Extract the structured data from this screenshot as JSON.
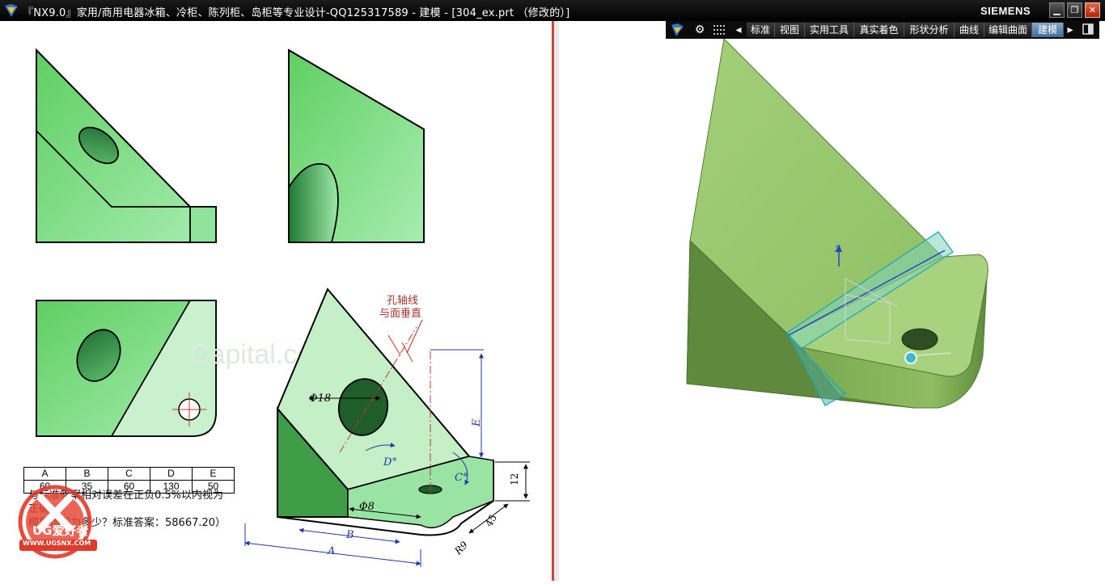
{
  "window": {
    "title": "『NX9.0』家用/商用电器冰箱、冷柜、陈列柜、岛柜等专业设计-QQ125317589 - 建模 - [304_ex.prt （修改的）]",
    "brand": "SIEMENS",
    "controls": [
      "minimize",
      "restore",
      "close"
    ]
  },
  "toolbar": {
    "tabs": [
      "标准",
      "视图",
      "实用工具",
      "真实着色",
      "形状分析",
      "曲线",
      "编辑曲面",
      "建模"
    ],
    "active_tab": "建模"
  },
  "drawing": {
    "annotation": [
      "孔轴线",
      "与面垂直"
    ],
    "dim_hole": "Φ18",
    "dim_small_hole": "Φ8",
    "dim_A": "A",
    "dim_B": "B",
    "dim_C": "C°",
    "dim_D": "D°",
    "dim_E": "E",
    "dim_12": "12",
    "dim_45": "45",
    "dim_r9": "R9",
    "watermark": "Capital.com"
  },
  "table": {
    "headers": [
      "A",
      "B",
      "C",
      "D",
      "E"
    ],
    "values": [
      "60",
      "35",
      "60",
      "130",
      "50"
    ]
  },
  "notes": {
    "line1": "与标准答案相对误差在正负0.5%以内视为",
    "line2": "正确",
    "line3": "模型体积为多少？标准答案：58667.20）"
  },
  "logo": {
    "text": "UG爱好者",
    "url": "WWW.UGSNX.COM"
  },
  "viewport": {
    "axis_label": "Z"
  },
  "colors": {
    "part_green": "#85dd85",
    "part_dark": "#3a9a46",
    "model_light": "#9fcb73",
    "model_dark": "#5f8a3e",
    "dim_blue": "#2236a8",
    "anno_red": "#b0342c"
  }
}
